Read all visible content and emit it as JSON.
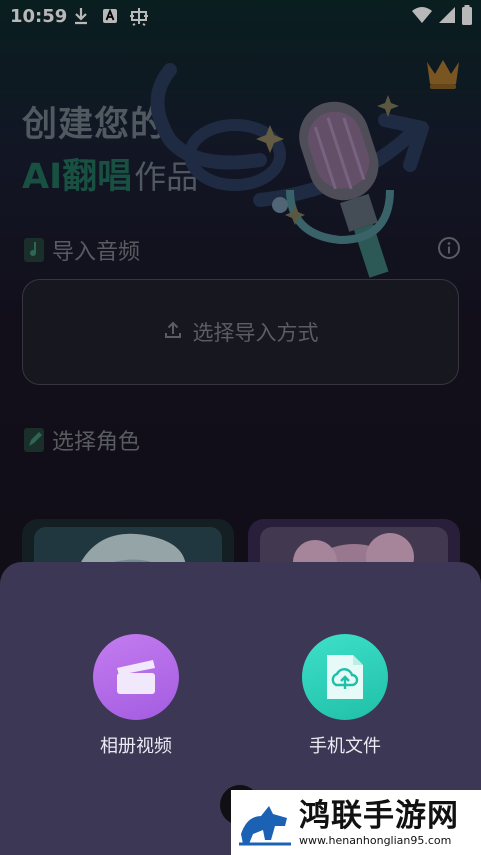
{
  "status_bar": {
    "time": "10:59",
    "left_icons": [
      "download-icon",
      "text-a-icon",
      "bug-icon"
    ],
    "right_icons": [
      "wifi-icon",
      "signal-icon",
      "battery-icon"
    ]
  },
  "hero": {
    "title_line1": "创建您的",
    "title_line2_accent": "AI翻唱",
    "title_line2_rest": "作品",
    "art": "microphone-illustration",
    "badge": "crown-icon"
  },
  "import_section": {
    "heading": "导入音频",
    "info_icon": "info-icon",
    "upload_label": "选择导入方式",
    "upload_icon": "upload-icon"
  },
  "role_section": {
    "heading": "选择角色",
    "cards": [
      "role-avatar-boy",
      "role-avatar-girl"
    ]
  },
  "sheet": {
    "options": [
      {
        "label": "相册视频",
        "icon": "video-clapper-icon",
        "color": "#b66ee9"
      },
      {
        "label": "手机文件",
        "icon": "cloud-upload-file-icon",
        "color": "#2fd3bb"
      }
    ]
  },
  "watermark": {
    "title": "鸿联手游网",
    "url": "www.henanhonglian95.com"
  },
  "colors": {
    "accent_green": "#22715a",
    "sheet_bg": "#3b3754",
    "purple": "#b66ee9",
    "teal": "#2fd3bb"
  }
}
